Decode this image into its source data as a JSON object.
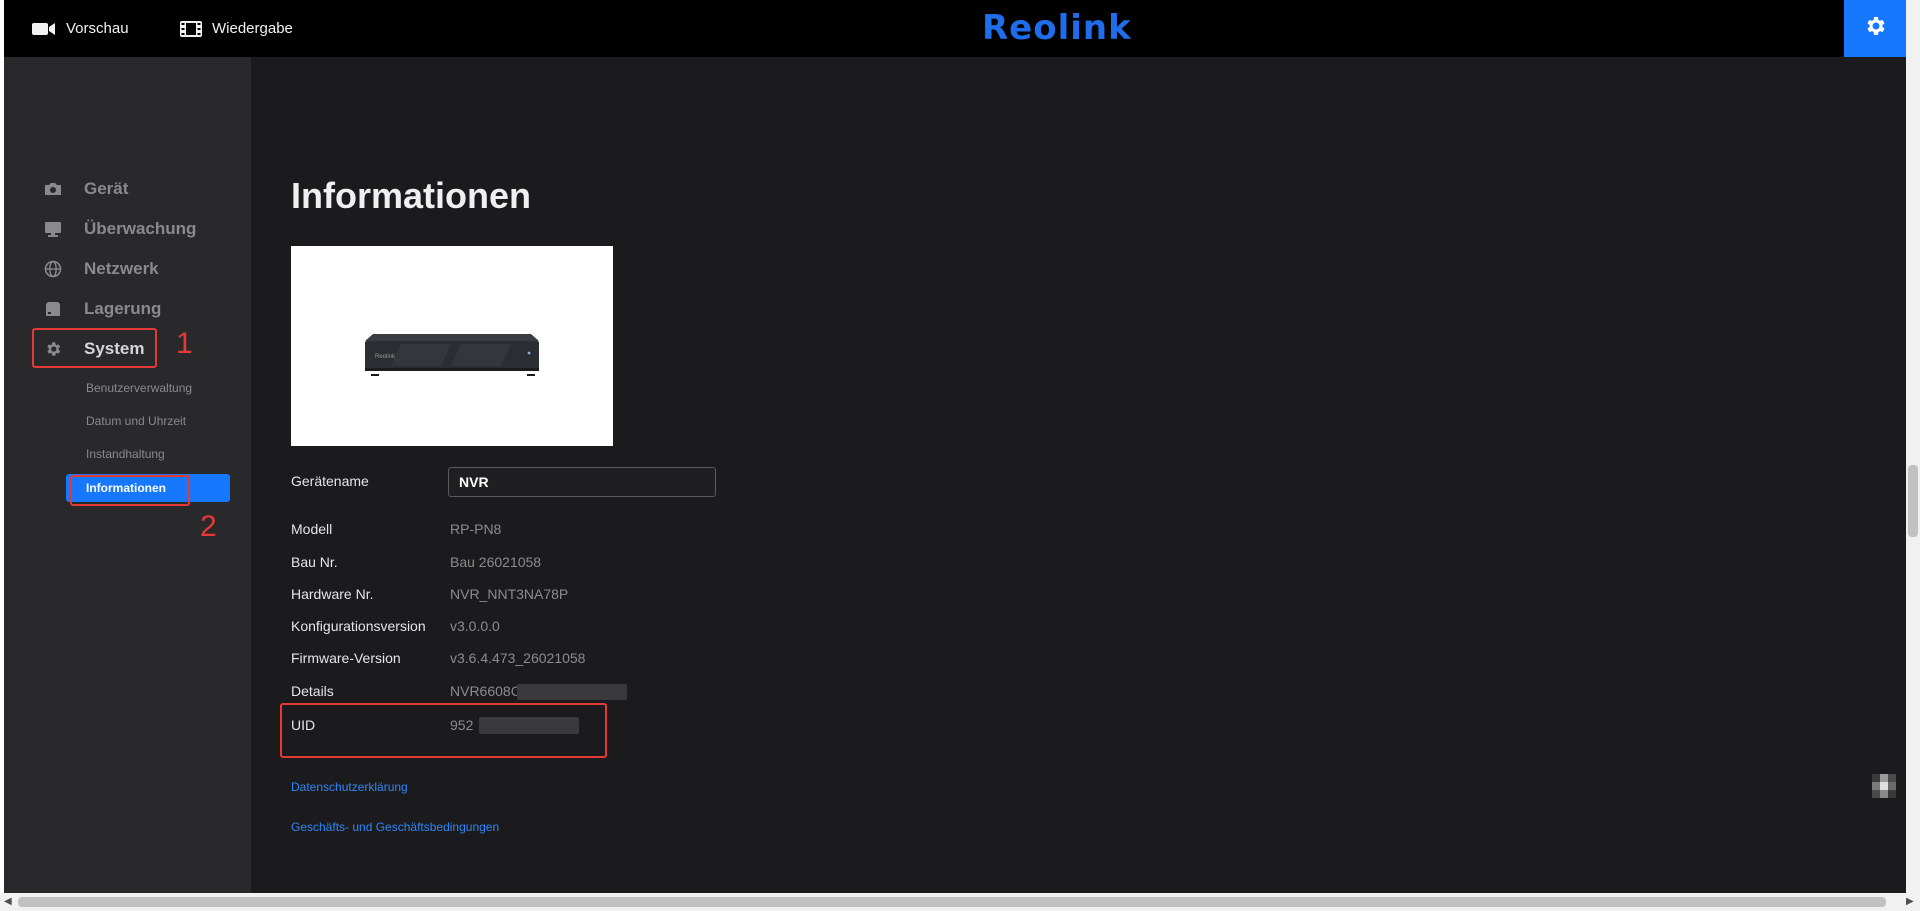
{
  "topbar": {
    "preview_label": "Vorschau",
    "playback_label": "Wiedergabe",
    "logo_text": "Reolink",
    "accent_color": "#1677ff"
  },
  "sidebar": {
    "items": [
      {
        "label": "Gerät",
        "icon": "camera-icon"
      },
      {
        "label": "Überwachung",
        "icon": "monitor-icon"
      },
      {
        "label": "Netzwerk",
        "icon": "globe-icon"
      },
      {
        "label": "Lagerung",
        "icon": "storage-icon"
      },
      {
        "label": "System",
        "icon": "gear-icon"
      }
    ],
    "subitems": [
      {
        "label": "Benutzerverwaltung"
      },
      {
        "label": "Datum und Uhrzeit"
      },
      {
        "label": "Instandhaltung"
      },
      {
        "label": "Informationen"
      }
    ],
    "annotation_1": "1",
    "annotation_2": "2"
  },
  "main": {
    "title": "Informationen",
    "device_name_label": "Gerätename",
    "device_name_value": "NVR",
    "device_image_brand": "Reolink",
    "fields": [
      {
        "label": "Modell",
        "value": "RP-PN8"
      },
      {
        "label": "Bau Nr.",
        "value": "Bau 26021058"
      },
      {
        "label": "Hardware Nr.",
        "value": "NVR_NNT3NA78P"
      },
      {
        "label": "Konfigurationsversion",
        "value": "v3.0.0.0"
      },
      {
        "label": "Firmware-Version",
        "value": "v3.6.4.473_26021058"
      },
      {
        "label": "Details",
        "value": "NVR6608C"
      },
      {
        "label": "UID",
        "value": "952"
      }
    ],
    "links": {
      "privacy": "Datenschutzerklärung",
      "terms": "Geschäfts- und Geschäftsbedingungen"
    }
  }
}
